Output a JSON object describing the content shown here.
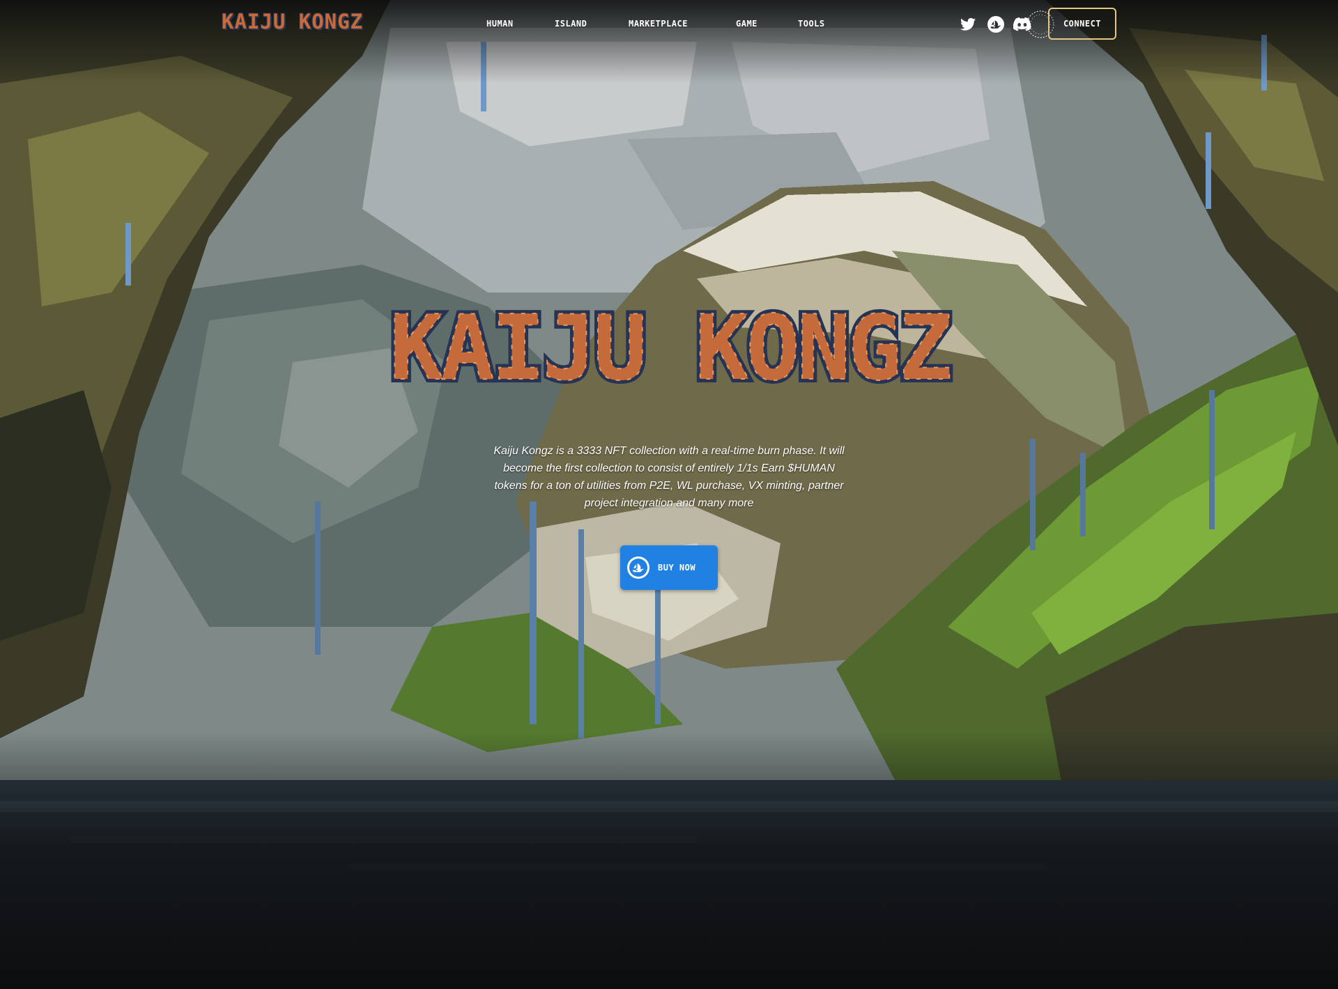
{
  "brand": {
    "logo_text": "KAIJU KONGZ"
  },
  "nav": {
    "items": [
      "HUMAN",
      "ISLAND",
      "MARKETPLACE",
      "GAME",
      "TOOLS"
    ]
  },
  "socials": [
    {
      "icon": "twitter-icon"
    },
    {
      "icon": "opensea-icon"
    },
    {
      "icon": "discord-icon"
    },
    {
      "icon": "looksrare-badge-icon"
    }
  ],
  "header": {
    "connect_label": "CONNECT"
  },
  "hero": {
    "title": "KAIJU KONGZ",
    "description": "Kaiju Kongz is a 3333 NFT collection with a real-time burn phase. It will become the first collection to consist of entirely 1/1s Earn $HUMAN tokens for a ton of utilities from P2E, WL purchase, VX minting, partner project integration and many more",
    "buy_label": "BUY NOW",
    "buy_icon": "opensea-icon"
  },
  "colors": {
    "accent_blue": "#2081e2",
    "connect_border": "#e7c787",
    "logo_orange": "#c96a3a",
    "logo_outline": "#2a3550"
  }
}
